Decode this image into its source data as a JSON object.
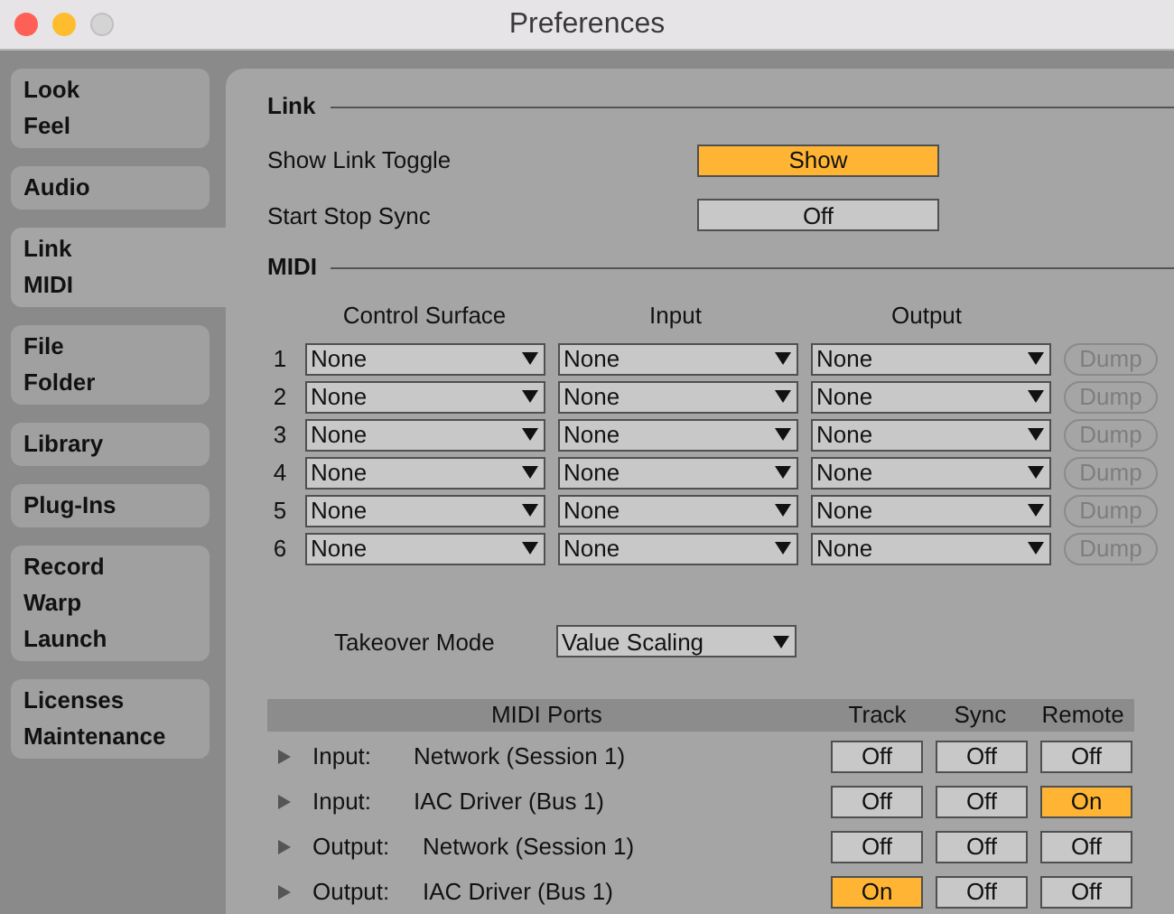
{
  "window": {
    "title": "Preferences"
  },
  "sidebar": {
    "items": [
      {
        "lines": [
          "Look",
          "Feel"
        ],
        "selected": false
      },
      {
        "lines": [
          "Audio"
        ],
        "selected": false
      },
      {
        "lines": [
          "Link",
          "MIDI"
        ],
        "selected": true
      },
      {
        "lines": [
          "File",
          "Folder"
        ],
        "selected": false
      },
      {
        "lines": [
          "Library"
        ],
        "selected": false
      },
      {
        "lines": [
          "Plug-Ins"
        ],
        "selected": false
      },
      {
        "lines": [
          "Record",
          "Warp",
          "Launch"
        ],
        "selected": false
      },
      {
        "lines": [
          "Licenses",
          "Maintenance"
        ],
        "selected": false
      }
    ]
  },
  "link": {
    "heading": "Link",
    "settings": [
      {
        "label": "Show Link Toggle",
        "value": "Show",
        "on": true
      },
      {
        "label": "Start Stop Sync",
        "value": "Off",
        "on": false
      }
    ]
  },
  "midi": {
    "heading": "MIDI",
    "columns": [
      "Control Surface",
      "Input",
      "Output"
    ],
    "rows": [
      {
        "number": "1",
        "control_surface": "None",
        "input": "None",
        "output": "None",
        "dump": "Dump",
        "disabled": true
      },
      {
        "number": "2",
        "control_surface": "None",
        "input": "None",
        "output": "None",
        "dump": "Dump",
        "disabled": true
      },
      {
        "number": "3",
        "control_surface": "None",
        "input": "None",
        "output": "None",
        "dump": "Dump",
        "disabled": true
      },
      {
        "number": "4",
        "control_surface": "None",
        "input": "None",
        "output": "None",
        "dump": "Dump",
        "disabled": true
      },
      {
        "number": "5",
        "control_surface": "None",
        "input": "None",
        "output": "None",
        "dump": "Dump",
        "disabled": true
      },
      {
        "number": "6",
        "control_surface": "None",
        "input": "None",
        "output": "None",
        "dump": "Dump",
        "disabled": true
      }
    ],
    "takeover": {
      "label": "Takeover Mode",
      "value": "Value Scaling"
    }
  },
  "ports": {
    "columns": [
      "MIDI Ports",
      "Track",
      "Sync",
      "Remote"
    ],
    "rows": [
      {
        "direction": "Input:",
        "name": "Network (Session 1)",
        "expanded": false,
        "toggles": [
          {
            "label": "Off",
            "on": false
          },
          {
            "label": "Off",
            "on": false
          },
          {
            "label": "Off",
            "on": false
          }
        ]
      },
      {
        "direction": "Input:",
        "name": "IAC Driver (Bus 1)",
        "expanded": false,
        "toggles": [
          {
            "label": "Off",
            "on": false
          },
          {
            "label": "Off",
            "on": false
          },
          {
            "label": "On",
            "on": true
          }
        ]
      },
      {
        "direction": "Output:",
        "name": "Network (Session 1)",
        "expanded": false,
        "toggles": [
          {
            "label": "Off",
            "on": false
          },
          {
            "label": "Off",
            "on": false
          },
          {
            "label": "Off",
            "on": false
          }
        ]
      },
      {
        "direction": "Output:",
        "name": "IAC Driver (Bus 1)",
        "expanded": false,
        "toggles": [
          {
            "label": "On",
            "on": true
          },
          {
            "label": "Off",
            "on": false
          },
          {
            "label": "Off",
            "on": false
          }
        ]
      }
    ]
  }
}
